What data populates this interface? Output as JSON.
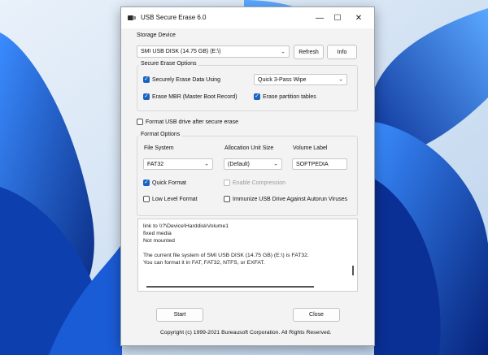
{
  "window": {
    "title": "USB Secure Erase 6.0",
    "minimize": "—",
    "maximize": "☐",
    "close": "✕"
  },
  "storage": {
    "label": "Storage Device",
    "device": "SMI USB DISK (14.75 GB) (E:\\)",
    "refresh": "Refresh",
    "info": "Info"
  },
  "secure": {
    "group_label": "Secure Erase Options",
    "securely_erase": {
      "label": "Securely Erase Data Using",
      "checked": true
    },
    "method": "Quick 3-Pass Wipe",
    "erase_mbr": {
      "label": "Erase MBR (Master Boot Record)",
      "checked": true
    },
    "erase_partitions": {
      "label": "Erase partition tables",
      "checked": true
    }
  },
  "format_after": {
    "label": "Format USB drive after secure erase",
    "checked": false
  },
  "format": {
    "group_label": "Format Options",
    "fs_label": "File System",
    "fs_value": "FAT32",
    "alloc_label": "Allocation Unit Size",
    "alloc_value": "(Default)",
    "vol_label": "Volume Label",
    "vol_value": "SOFTPEDIA",
    "quick": {
      "label": "Quick Format",
      "checked": true
    },
    "compression": {
      "label": "Enable Compression",
      "checked": false
    },
    "low_level": {
      "label": "Low Level Format",
      "checked": false
    },
    "immunize": {
      "label": "Immunize USB Drive Against Autorun Viruses",
      "checked": false
    }
  },
  "log": {
    "lines": [
      "link to \\\\?\\Device\\HarddiskVolume1",
      "fixed media",
      "Not mounted",
      "",
      "The current file system of SMI USB DISK (14.75 GB) (E:\\) is FAT32.",
      "You can format it in FAT, FAT32, NTFS, or EXFAT."
    ]
  },
  "actions": {
    "start": "Start",
    "close": "Close"
  },
  "footer": {
    "copyright": "Copyright (c) 1999-2021 Bureausoft Corporation. All Rights Reserved."
  },
  "colors": {
    "accent": "#1863c4",
    "wallpaper": "#0b3fa8"
  }
}
